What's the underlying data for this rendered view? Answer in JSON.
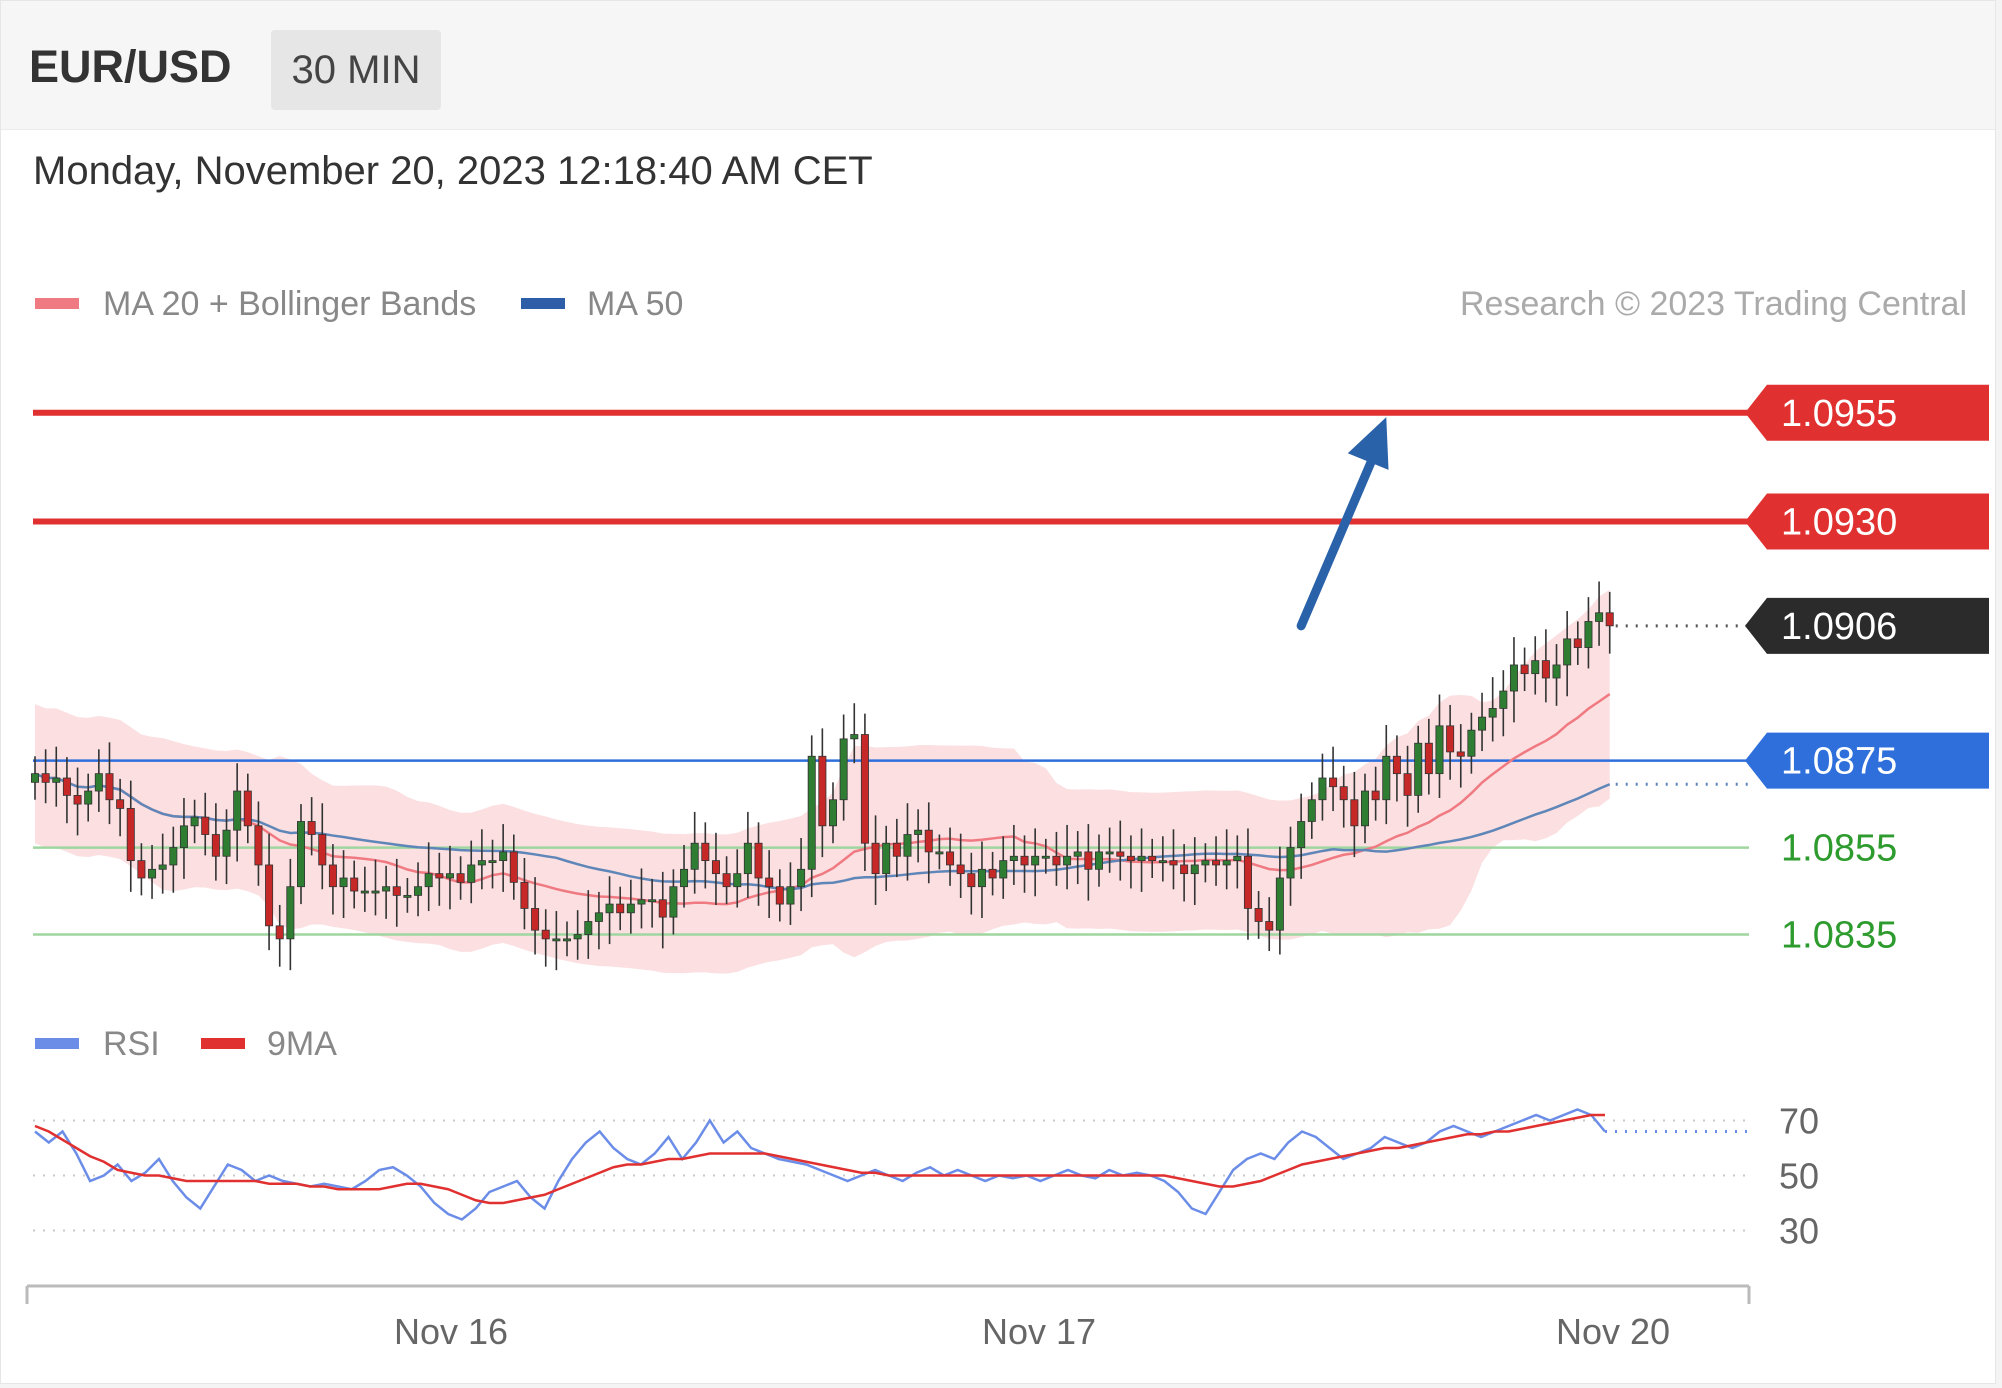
{
  "header": {
    "symbol": "EUR/USD",
    "timeframe": "30 MIN"
  },
  "timestamp": "Monday, November 20, 2023 12:18:40 AM CET",
  "legend": {
    "ma20": "MA 20 + Bollinger Bands",
    "ma50": "MA 50",
    "copyright": "Research © 2023 Trading Central",
    "rsi": "RSI",
    "rsi_ma": "9MA"
  },
  "colors": {
    "resistance": "#e03030",
    "support": "#2d9b2d",
    "current": "#2b2b2b",
    "ma50": "#2f6fdc",
    "bull_candle": "#2f7d32",
    "bear_candle": "#c62828",
    "bands": "#f7c5c8",
    "ma20": "#f07a82",
    "ma50_line": "#5f86b8",
    "arrow": "#2a62aa",
    "rsi": "#6b8de8",
    "rsi_ma": "#e0302f"
  },
  "chart_data": [
    {
      "type": "candlestick",
      "x_labels": [
        "Nov 16",
        "Nov 17",
        "Nov 20"
      ],
      "ylim": [
        1.0825,
        1.0963
      ],
      "levels": [
        {
          "label": "1.0955",
          "value": 1.0955,
          "kind": "resistance"
        },
        {
          "label": "1.0930",
          "value": 1.093,
          "kind": "resistance"
        },
        {
          "label": "1.0906",
          "value": 1.0906,
          "kind": "current"
        },
        {
          "label": "1.0875",
          "value": 1.0875,
          "kind": "ma50"
        },
        {
          "label": "1.0855",
          "value": 1.0855,
          "kind": "support"
        },
        {
          "label": "1.0835",
          "value": 1.0835,
          "kind": "support"
        }
      ],
      "forecast": {
        "from_bar": 119,
        "from_price": 1.0906,
        "to_bar": 127,
        "to_price": 1.0954
      },
      "close": [
        1.0872,
        1.087,
        1.0871,
        1.0867,
        1.0865,
        1.0868,
        1.0872,
        1.0866,
        1.0864,
        1.0852,
        1.0848,
        1.085,
        1.0851,
        1.0855,
        1.086,
        1.0862,
        1.0858,
        1.0853,
        1.0859,
        1.0868,
        1.086,
        1.0851,
        1.0837,
        1.0834,
        1.0846,
        1.0861,
        1.0858,
        1.0851,
        1.0846,
        1.0848,
        1.0845,
        1.0845,
        1.0845,
        1.0846,
        1.0844,
        1.0844,
        1.0846,
        1.0849,
        1.0848,
        1.0849,
        1.0847,
        1.0851,
        1.0852,
        1.0852,
        1.0854,
        1.0847,
        1.0841,
        1.0836,
        1.0834,
        1.0834,
        1.0834,
        1.0835,
        1.0838,
        1.084,
        1.0842,
        1.084,
        1.0842,
        1.0843,
        1.0843,
        1.0839,
        1.0846,
        1.085,
        1.0856,
        1.0852,
        1.0849,
        1.0846,
        1.0849,
        1.0856,
        1.0848,
        1.0846,
        1.0842,
        1.0846,
        1.085,
        1.0876,
        1.086,
        1.0866,
        1.088,
        1.0881,
        1.0856,
        1.0849,
        1.0856,
        1.0853,
        1.0858,
        1.0859,
        1.0854,
        1.0854,
        1.0851,
        1.0849,
        1.0846,
        1.085,
        1.0848,
        1.0852,
        1.0853,
        1.0851,
        1.0853,
        1.0853,
        1.0851,
        1.0853,
        1.0854,
        1.085,
        1.0854,
        1.0854,
        1.0853,
        1.0852,
        1.0853,
        1.0852,
        1.0852,
        1.0851,
        1.0849,
        1.0851,
        1.0852,
        1.0851,
        1.0852,
        1.0853,
        1.0841,
        1.0838,
        1.0836,
        1.0848,
        1.0855,
        1.0861,
        1.0866,
        1.0871,
        1.0869,
        1.0866,
        1.086,
        1.0868,
        1.0866,
        1.0876,
        1.0872,
        1.0867,
        1.0879,
        1.0872,
        1.0883,
        1.0877,
        1.0876,
        1.0882,
        1.0885,
        1.0887,
        1.0891,
        1.0897,
        1.0895,
        1.0898,
        1.0894,
        1.0897,
        1.0903,
        1.0901,
        1.0907,
        1.0909,
        1.0906
      ]
    },
    {
      "type": "line",
      "series": [
        {
          "name": "RSI",
          "values": [
            66,
            62,
            66,
            58,
            48,
            50,
            54,
            48,
            51,
            56,
            48,
            42,
            38,
            46,
            54,
            52,
            48,
            50,
            48,
            47,
            46,
            47,
            46,
            45,
            48,
            52,
            53,
            50,
            46,
            40,
            36,
            34,
            38,
            44,
            46,
            48,
            42,
            38,
            48,
            56,
            62,
            66,
            60,
            56,
            54,
            58,
            64,
            56,
            62,
            70,
            62,
            66,
            60,
            58,
            56,
            55,
            54,
            52,
            50,
            48,
            50,
            52,
            50,
            48,
            51,
            53,
            50,
            52,
            50,
            48,
            50,
            49,
            50,
            48,
            50,
            52,
            50,
            49,
            52,
            50,
            51,
            50,
            48,
            44,
            38,
            36,
            44,
            52,
            56,
            58,
            56,
            62,
            66,
            64,
            60,
            56,
            58,
            60,
            64,
            62,
            60,
            62,
            66,
            68,
            66,
            64,
            66,
            68,
            70,
            72,
            70,
            72,
            74,
            72,
            66
          ]
        },
        {
          "name": "9MA",
          "values": [
            68,
            66,
            63,
            60,
            57,
            55,
            52,
            51,
            50,
            50,
            49,
            48,
            48,
            48,
            48,
            48,
            48,
            47,
            47,
            47,
            46,
            46,
            45,
            45,
            45,
            45,
            46,
            47,
            47,
            46,
            45,
            43,
            41,
            40,
            40,
            41,
            42,
            43,
            45,
            47,
            49,
            51,
            53,
            54,
            54,
            55,
            56,
            56,
            57,
            58,
            58,
            58,
            58,
            58,
            57,
            56,
            55,
            54,
            53,
            52,
            51,
            51,
            50,
            50,
            50,
            50,
            50,
            50,
            50,
            50,
            50,
            50,
            50,
            50,
            50,
            50,
            50,
            50,
            50,
            50,
            50,
            50,
            50,
            49,
            48,
            47,
            46,
            46,
            47,
            48,
            50,
            52,
            54,
            55,
            56,
            57,
            58,
            59,
            60,
            60,
            61,
            62,
            63,
            64,
            65,
            65,
            66,
            66,
            67,
            68,
            69,
            70,
            71,
            72,
            72
          ]
        }
      ],
      "ylim": [
        20,
        80
      ],
      "ticks": [
        "70",
        "50",
        "30"
      ]
    }
  ]
}
